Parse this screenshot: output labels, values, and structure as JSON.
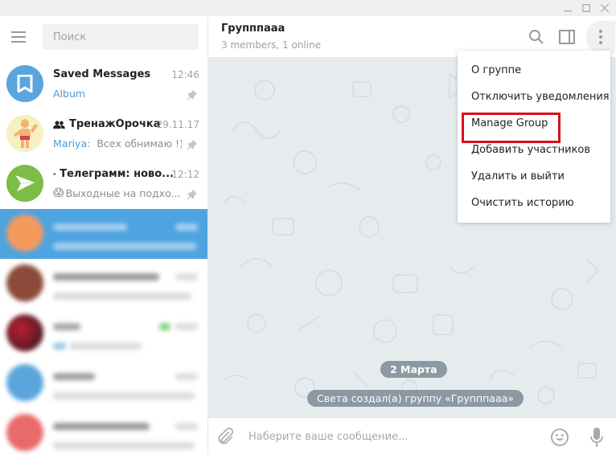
{
  "window": {
    "controls": [
      "minimize",
      "maximize",
      "close"
    ]
  },
  "sidebar": {
    "search_placeholder": "Поиск",
    "chats": [
      {
        "name": "Saved Messages",
        "time": "12:46",
        "message": "Album",
        "message_is_link": true,
        "pinned": true,
        "avatar": "bookmark-icon",
        "avatar_color": "#5aa5dc"
      },
      {
        "name": "ТренажОрочка",
        "type_icon": "group-icon",
        "time": "29.11.17",
        "sender": "Mariya:",
        "message": "Всех обнимаю !)))",
        "pinned": true,
        "avatar": "cartoon-strongman",
        "avatar_color": "#f7f0c2"
      },
      {
        "name": "Телеграмм: ново...",
        "type_icon": "megaphone-icon",
        "time": "12:12",
        "message": "Выходные на подхо...",
        "message_emoji": "😱",
        "pinned": true,
        "avatar": "paper-plane-icon",
        "avatar_color": "#7bbd46"
      },
      {
        "name": "[blurred]",
        "blurred": true,
        "active": true,
        "avatar_color": "#f59a5c"
      },
      {
        "name": "[blurred]",
        "blurred": true,
        "avatar_color": "#8b4a3a"
      },
      {
        "name": "[blurred]",
        "blurred": true,
        "avatar_color": "#6e1f2a",
        "read_check": true
      },
      {
        "name": "[blurred]",
        "blurred": true,
        "avatar_color": "#5aa5dc"
      },
      {
        "name": "[blurred]",
        "blurred": true,
        "avatar_color": "#e96a6a"
      }
    ]
  },
  "header": {
    "title": "Групппааа",
    "subtitle": "3 members, 1 online"
  },
  "menu": {
    "items": [
      {
        "label": "О группе"
      },
      {
        "label": "Отключить уведомления"
      },
      {
        "label": "Manage Group",
        "highlighted": true
      },
      {
        "label": "Добавить участников"
      },
      {
        "label": "Удалить и выйти"
      },
      {
        "label": "Очистить историю"
      }
    ],
    "highlight_color": "#d8101b"
  },
  "messages": {
    "date": "2 Марта",
    "service_message": "Света создал(а) группу «Групппааа»"
  },
  "composer": {
    "placeholder": "Наберите ваше сообщение..."
  },
  "colors": {
    "accent": "#4ea4e0",
    "link": "#4c9bd1",
    "chat_bg": "#e6ebee",
    "service_pill": "#8c99a2"
  }
}
